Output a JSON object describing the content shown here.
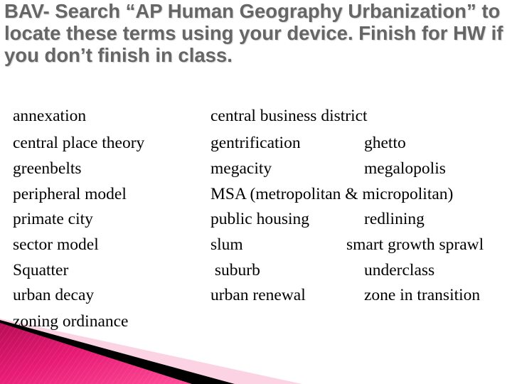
{
  "slide": {
    "title": "BAV- Search “AP Human Geography Urbanization” to locate these terms using your device. Finish for HW if you don’t finish in class.",
    "accent_color": "#d9176a",
    "left_terms": [
      "annexation",
      "central place theory",
      "greenbelts",
      "peripheral model",
      "primate city",
      "sector model",
      "Squatter",
      "urban decay",
      "zoning ordinance"
    ],
    "right_rows": [
      {
        "a": "central business district",
        "b": ""
      },
      {
        "a": "gentrification",
        "b": "ghetto"
      },
      {
        "a": "megacity",
        "b": "megalopolis"
      },
      {
        "a": "MSA (metropolitan & micropolitan)",
        "b": ""
      },
      {
        "a": "public housing",
        "b": "redlining"
      },
      {
        "a": "slum",
        "b": "smart growth sprawl"
      },
      {
        "a": " suburb",
        "b": "underclass"
      },
      {
        "a": "urban renewal",
        "b": "zone in transition"
      }
    ]
  }
}
